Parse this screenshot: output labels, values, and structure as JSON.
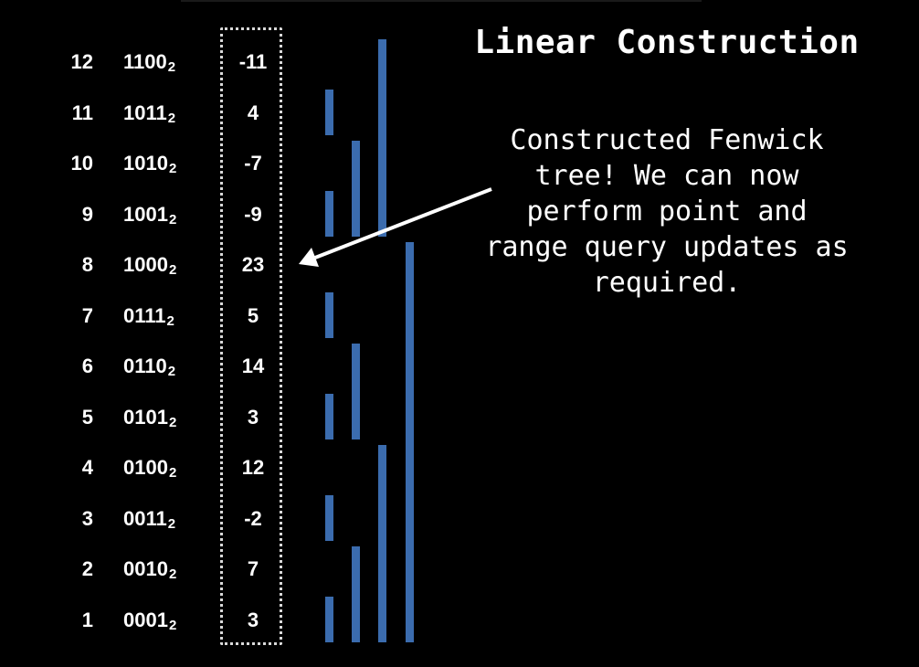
{
  "title": "Linear Construction",
  "note_lines": [
    "Constructed Fenwick",
    "tree! We can now",
    "perform point and",
    "range query updates as",
    "required."
  ],
  "rows": [
    {
      "index": "12",
      "binary": "1100",
      "base": "2",
      "value": "-11"
    },
    {
      "index": "11",
      "binary": "1011",
      "base": "2",
      "value": "4"
    },
    {
      "index": "10",
      "binary": "1010",
      "base": "2",
      "value": "-7"
    },
    {
      "index": "9",
      "binary": "1001",
      "base": "2",
      "value": "-9"
    },
    {
      "index": "8",
      "binary": "1000",
      "base": "2",
      "value": "23"
    },
    {
      "index": "7",
      "binary": "0111",
      "base": "2",
      "value": "5"
    },
    {
      "index": "6",
      "binary": "0110",
      "base": "2",
      "value": "14"
    },
    {
      "index": "5",
      "binary": "0101",
      "base": "2",
      "value": "3"
    },
    {
      "index": "4",
      "binary": "0100",
      "base": "2",
      "value": "12"
    },
    {
      "index": "3",
      "binary": "0011",
      "base": "2",
      "value": "-2"
    },
    {
      "index": "2",
      "binary": "0010",
      "base": "2",
      "value": "7"
    },
    {
      "index": "1",
      "binary": "0001",
      "base": "2",
      "value": "3"
    }
  ],
  "ranges": [
    {
      "from": 1,
      "to": 1
    },
    {
      "from": 3,
      "to": 3
    },
    {
      "from": 5,
      "to": 5
    },
    {
      "from": 7,
      "to": 7
    },
    {
      "from": 9,
      "to": 9
    },
    {
      "from": 11,
      "to": 11
    },
    {
      "from": 1,
      "to": 2
    },
    {
      "from": 5,
      "to": 6
    },
    {
      "from": 9,
      "to": 10
    },
    {
      "from": 1,
      "to": 4
    },
    {
      "from": 9,
      "to": 12
    },
    {
      "from": 1,
      "to": 8
    }
  ],
  "colors": {
    "background": "#000000",
    "text": "#ffffff",
    "bar": "#3b6cae",
    "box_border": "#d9d9d9",
    "arrow": "#ffffff"
  }
}
